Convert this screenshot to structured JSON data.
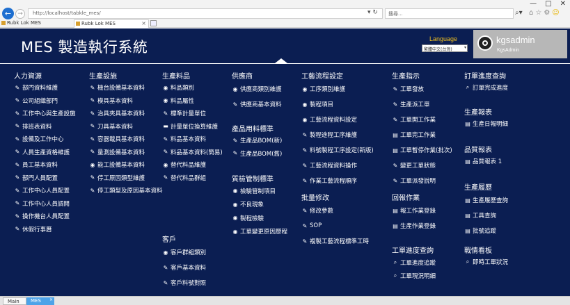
{
  "browser": {
    "url": "http://localhost/tabkle_mes/",
    "search_placeholder": "搜尋...",
    "tabs": [
      {
        "label": "Rubk Lok MES"
      },
      {
        "label": "Rubk Lok MES"
      }
    ]
  },
  "header": {
    "title": "MES 製造執行系統",
    "language_label": "Language",
    "language_value": "繁體中文(台灣)",
    "username": "kgsadmin",
    "user_role": "KgsAdmin"
  },
  "menu": {
    "hr": {
      "title": "人力資源",
      "items": [
        "部門資料維護",
        "公司組織部門",
        "工作中心與生產設施",
        "排班表資料",
        "設備及工作中心",
        "人員生產資格維護",
        "員工基本資料",
        "部門人員配置",
        "工作中心人員配置",
        "工作中心人員調閱",
        "操作機台人員配置",
        "休假行事曆"
      ]
    },
    "production": {
      "title": "生產設施",
      "items": [
        "機台設備基本資料",
        "模具基本資料",
        "治具夾具基本資料",
        "刀具基本資料",
        "容器載具基本資料",
        "量測設備基本資料",
        "能工設備基本資料",
        "停工原因類型維護",
        "停工類型及原因基本資料"
      ]
    },
    "material": {
      "title": "生產料品",
      "items": [
        "料品類別",
        "料品屬性",
        "標準計量單位",
        "計量單位換算維護",
        "料品基本資料",
        "料品基本資料(簡易)",
        "替代料品維護",
        "替代料品群組"
      ]
    },
    "customer": {
      "title": "客戶",
      "items": [
        "客戶群組類別",
        "客戶基本資料",
        "客戶料號對照"
      ]
    },
    "vendor": {
      "title": "供應商",
      "items": [
        "供應商類別維護",
        "供應商基本資料"
      ]
    },
    "bom": {
      "title": "產品用料標準",
      "items": [
        "生產品BOM(新)",
        "生產品BOM(舊)"
      ]
    },
    "quality": {
      "title": "質檢管制標準",
      "items": [
        "檢驗管制項目",
        "不良現象",
        "製程檢驗",
        "工單變更原因歷程"
      ]
    },
    "routing": {
      "title": "工藝流程設定",
      "items": [
        "工序類別維護",
        "製程項目",
        "工藝流程資料設定",
        "製程途程工序維護",
        "料號製程工序設定(新版)",
        "工藝流程資料操作",
        "作業工藝流程順序"
      ]
    },
    "batch": {
      "title": "批量修改",
      "items": [
        "修改參數",
        "SOP",
        "複製工藝流程標準工時"
      ]
    },
    "dispatch": {
      "title": "生產指示",
      "items": [
        "工單發放",
        "生產派工單",
        "工單開工作業",
        "工單完工作業",
        "工單暫停作業(批次)",
        "變更工單狀態",
        "工單派發說明"
      ]
    },
    "report_op": {
      "title": "回報作業",
      "items": [
        "報工作業登錄",
        "生產作業登錄"
      ]
    },
    "wo_query": {
      "title": "工單進度查詢",
      "items": [
        "工單進度追蹤",
        "工單現況明細"
      ]
    },
    "order_query": {
      "title": "訂單進度查詢",
      "items": [
        "訂單完成進度"
      ]
    },
    "prod_report": {
      "title": "生產報表",
      "items": [
        "生產日報明細"
      ]
    },
    "quality_report": {
      "title": "品質報表",
      "items": [
        "品質報表 1"
      ]
    },
    "history": {
      "title": "生產履歷",
      "items": [
        "生產履歷查詢",
        "工具查詢",
        "批號追蹤"
      ]
    },
    "dashboard": {
      "title": "戰情看板",
      "items": [
        "即時工單狀況"
      ]
    }
  },
  "bottom_tabs": {
    "main": "Main",
    "mes": "MES"
  }
}
